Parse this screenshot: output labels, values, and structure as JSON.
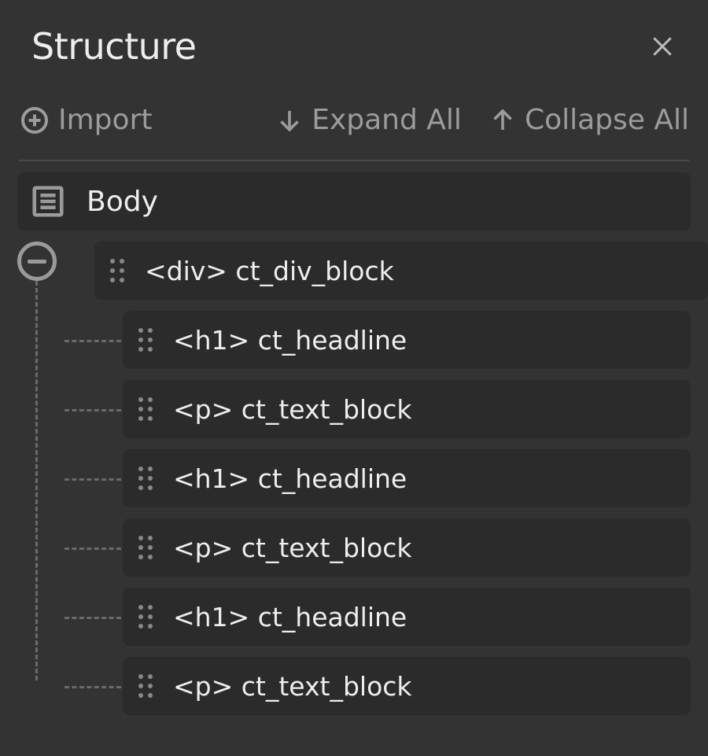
{
  "header": {
    "title": "Structure"
  },
  "toolbar": {
    "import_label": "Import",
    "expand_label": "Expand All",
    "collapse_label": "Collapse All"
  },
  "tree": {
    "root_label": "Body",
    "parent_label": "<div> ct_div_block",
    "children": [
      {
        "label": "<h1> ct_headline"
      },
      {
        "label": "<p> ct_text_block"
      },
      {
        "label": "<h1> ct_headline"
      },
      {
        "label": "<p> ct_text_block"
      },
      {
        "label": "<h1> ct_headline"
      },
      {
        "label": "<p> ct_text_block"
      }
    ]
  }
}
